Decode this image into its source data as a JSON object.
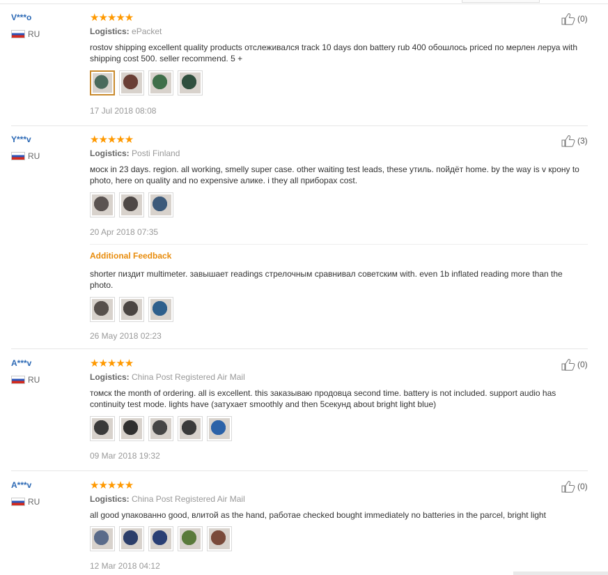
{
  "reviews": [
    {
      "user": "V***o",
      "country": "RU",
      "rating": "★★★★★",
      "logistics_label": "Logistics:",
      "logistics": "ePacket",
      "text": "rostov shipping excellent quality products отслеживался track 10 days don battery rub 400 обошлось priced по мерлен леруа with shipping cost 500. seller recommend. 5 +",
      "photos": [
        "#4a6a5c",
        "#6a3e35",
        "#3f6f4a",
        "#2f4f3e"
      ],
      "date": "17 Jul 2018 08:08",
      "useful": "(0)"
    },
    {
      "user": "Y***v",
      "country": "RU",
      "rating": "★★★★★",
      "logistics_label": "Logistics:",
      "logistics": "Posti Finland",
      "text": "моск in 23 days. region. all working, smelly super case. other waiting test leads, these утиль. пойдёт home. by the way is v крону to photo, here on quality and no expensive алике. i they all приборах cost.",
      "photos": [
        "#5b5452",
        "#4e4846",
        "#3d5a7a"
      ],
      "date": "20 Apr 2018 07:35",
      "useful": "(3)",
      "additional": {
        "title": "Additional Feedback",
        "text": "shorter пиздит multimeter. завышает readings стрелочным сравнивал советским with. even 1b inflated reading more than the photo.",
        "photos": [
          "#57504c",
          "#4b4542",
          "#2e5f8c"
        ],
        "date": "26 May 2018 02:23"
      }
    },
    {
      "user": "A***v",
      "country": "RU",
      "rating": "★★★★★",
      "logistics_label": "Logistics:",
      "logistics": "China Post Registered Air Mail",
      "text": "томск the month of ordering. all is excellent. this заказываю продовца second time. battery is not included. support audio has continuity test mode. lights have (затухает smoothly and then 5секунд about bright light blue)",
      "photos": [
        "#3a3a3a",
        "#2f2f2f",
        "#454545",
        "#3a3a3a",
        "#2c62a8"
      ],
      "date": "09 Mar 2018 19:32",
      "useful": "(0)"
    },
    {
      "user": "A***v",
      "country": "RU",
      "rating": "★★★★★",
      "logistics_label": "Logistics:",
      "logistics": "China Post Registered Air Mail",
      "text": "all good упакованно good, влитой as the hand, работае checked bought immediately no batteries in the parcel, bright light",
      "photos": [
        "#5a6b8a",
        "#2c3e6a",
        "#2a3f74",
        "#5a7a3a",
        "#7a4a3a"
      ],
      "date": "12 Mar 2018 04:12",
      "useful": "(0)"
    }
  ]
}
